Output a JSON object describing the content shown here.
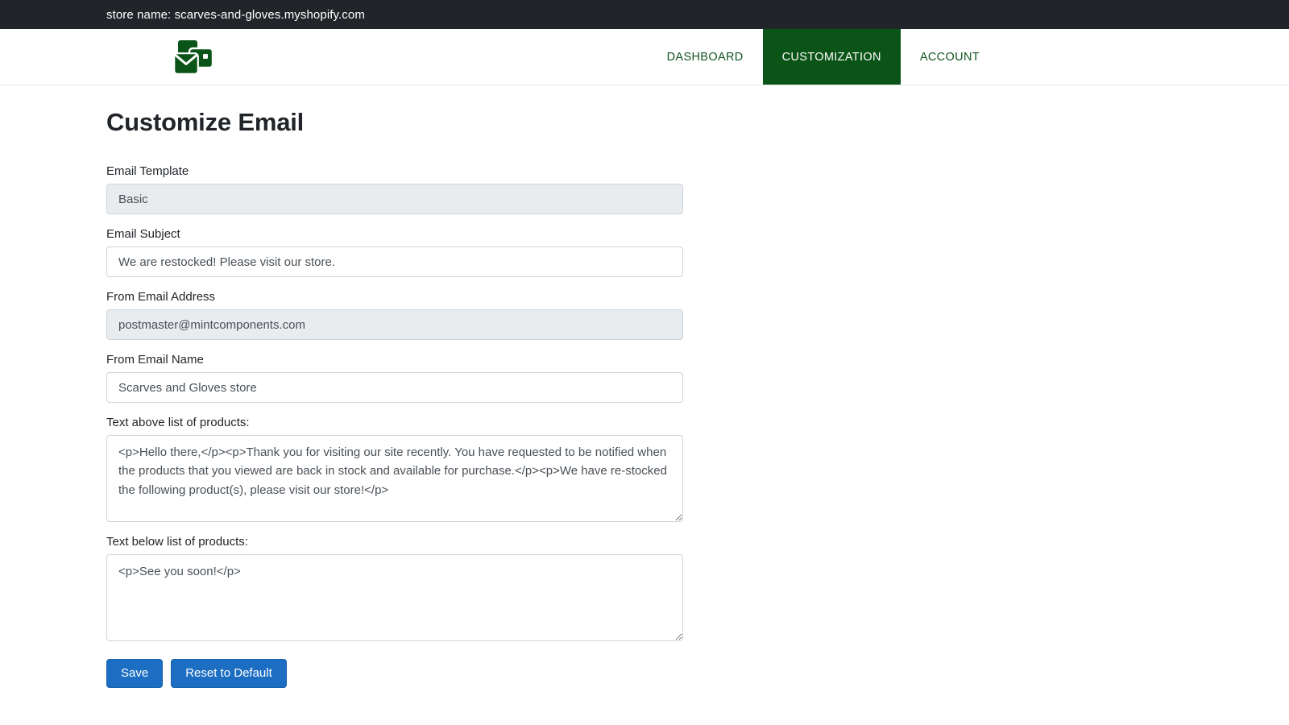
{
  "store_bar": {
    "text": "store name: scarves-and-gloves.myshopify.com"
  },
  "navbar": {
    "logo_name": "mail-store-logo",
    "links": [
      {
        "label": "DASHBOARD",
        "active": false
      },
      {
        "label": "CUSTOMIZATION",
        "active": true
      },
      {
        "label": "ACCOUNT",
        "active": false
      }
    ]
  },
  "main": {
    "title": "Customize Email",
    "fields": {
      "email_template": {
        "label": "Email Template",
        "value": "Basic",
        "placeholder": ""
      },
      "email_subject": {
        "label": "Email Subject",
        "value": "We are restocked! Please visit our store.",
        "placeholder": ""
      },
      "from_email_address": {
        "label": "From Email Address",
        "value": "postmaster@mintcomponents.com",
        "placeholder": ""
      },
      "from_email_name": {
        "label": "From Email Name",
        "value": "Scarves and Gloves store",
        "placeholder": ""
      },
      "text_above": {
        "label": "Text above list of products:",
        "value": "<p>Hello there,</p><p>Thank you for visiting our site recently. You have requested to be notified when the products that you viewed are back in stock and available for purchase.</p><p>We have re-stocked the following product(s), please visit our store!</p>",
        "placeholder": ""
      },
      "text_below": {
        "label": "Text below list of products:",
        "value": "<p>See you soon!</p>",
        "placeholder": ""
      }
    },
    "buttons": {
      "save_label": "Save",
      "reset_label": "Reset to Default"
    }
  },
  "colors": {
    "topbar_bg": "#212529",
    "nav_active_bg": "#0b5417",
    "nav_link_text": "#13551f",
    "button_blue": "#1b6ec2",
    "disabled_field_bg": "#e9ecef",
    "logo_green": "#0b5417"
  }
}
